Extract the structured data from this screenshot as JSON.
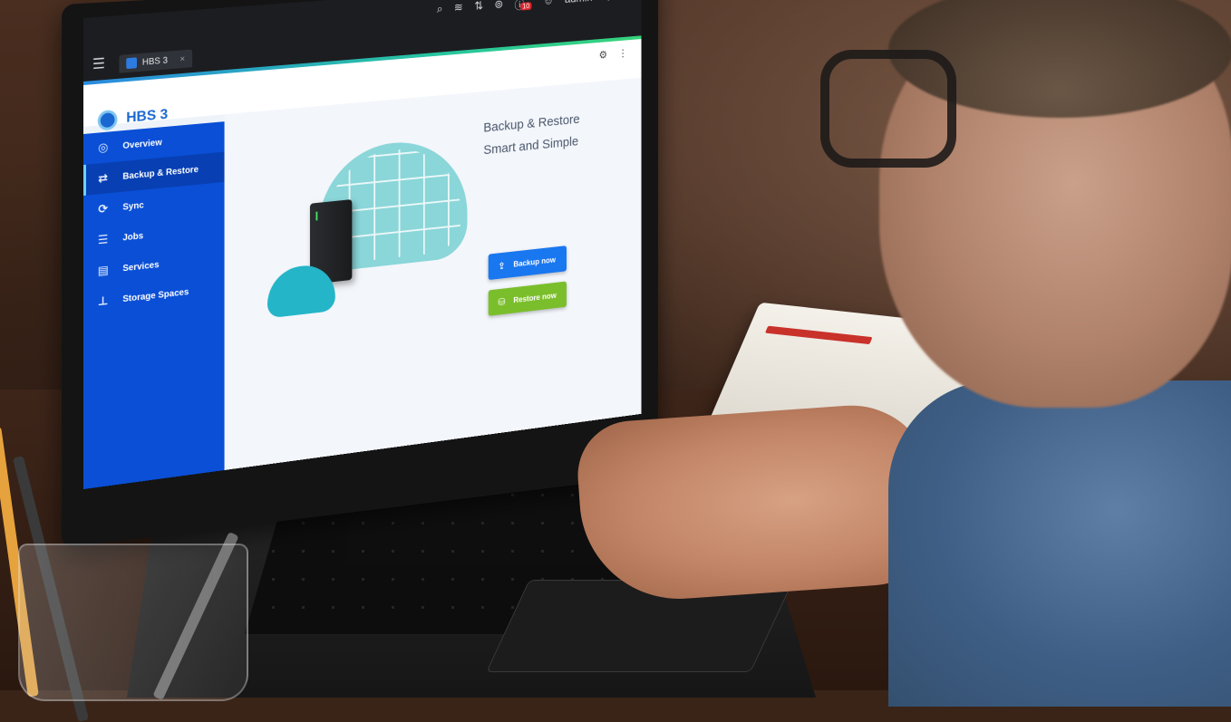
{
  "topbar": {
    "app_tab_label": "HBS 3",
    "user_label": "admin",
    "notification_count": "10",
    "icons": [
      "search-icon",
      "tasks-icon",
      "transfer-icon",
      "external-device-icon",
      "notifications-icon",
      "user-icon",
      "more-icon",
      "dashboard-icon"
    ]
  },
  "app": {
    "title": "HBS 3",
    "accent_colors": [
      "#2a8be0",
      "#27c4a0",
      "#36d47a"
    ]
  },
  "sidebar": {
    "items": [
      {
        "label": "Overview",
        "icon": "overview-icon"
      },
      {
        "label": "Backup & Restore",
        "icon": "backup-restore-icon",
        "active": true
      },
      {
        "label": "Sync",
        "icon": "sync-icon"
      },
      {
        "label": "Jobs",
        "icon": "jobs-icon"
      },
      {
        "label": "Services",
        "icon": "services-icon"
      },
      {
        "label": "Storage Spaces",
        "icon": "storage-spaces-icon"
      }
    ]
  },
  "main": {
    "headline_line1": "Backup & Restore",
    "headline_line2": "Smart and Simple",
    "backup_button": "Backup now",
    "restore_button": "Restore now"
  }
}
